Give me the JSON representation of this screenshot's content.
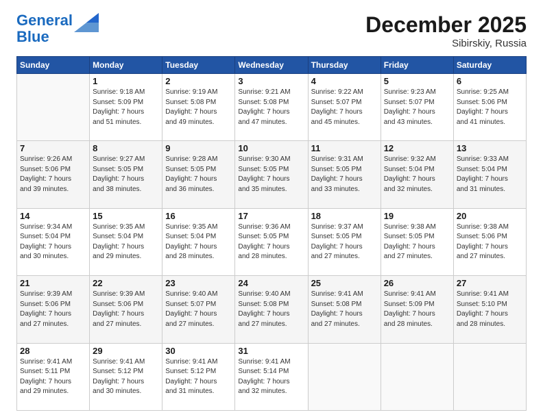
{
  "header": {
    "logo_line1": "General",
    "logo_line2": "Blue",
    "title": "December 2025",
    "subtitle": "Sibirskiy, Russia"
  },
  "weekdays": [
    "Sunday",
    "Monday",
    "Tuesday",
    "Wednesday",
    "Thursday",
    "Friday",
    "Saturday"
  ],
  "weeks": [
    [
      {
        "day": "",
        "info": ""
      },
      {
        "day": "1",
        "info": "Sunrise: 9:18 AM\nSunset: 5:09 PM\nDaylight: 7 hours\nand 51 minutes."
      },
      {
        "day": "2",
        "info": "Sunrise: 9:19 AM\nSunset: 5:08 PM\nDaylight: 7 hours\nand 49 minutes."
      },
      {
        "day": "3",
        "info": "Sunrise: 9:21 AM\nSunset: 5:08 PM\nDaylight: 7 hours\nand 47 minutes."
      },
      {
        "day": "4",
        "info": "Sunrise: 9:22 AM\nSunset: 5:07 PM\nDaylight: 7 hours\nand 45 minutes."
      },
      {
        "day": "5",
        "info": "Sunrise: 9:23 AM\nSunset: 5:07 PM\nDaylight: 7 hours\nand 43 minutes."
      },
      {
        "day": "6",
        "info": "Sunrise: 9:25 AM\nSunset: 5:06 PM\nDaylight: 7 hours\nand 41 minutes."
      }
    ],
    [
      {
        "day": "7",
        "info": "Sunrise: 9:26 AM\nSunset: 5:06 PM\nDaylight: 7 hours\nand 39 minutes."
      },
      {
        "day": "8",
        "info": "Sunrise: 9:27 AM\nSunset: 5:05 PM\nDaylight: 7 hours\nand 38 minutes."
      },
      {
        "day": "9",
        "info": "Sunrise: 9:28 AM\nSunset: 5:05 PM\nDaylight: 7 hours\nand 36 minutes."
      },
      {
        "day": "10",
        "info": "Sunrise: 9:30 AM\nSunset: 5:05 PM\nDaylight: 7 hours\nand 35 minutes."
      },
      {
        "day": "11",
        "info": "Sunrise: 9:31 AM\nSunset: 5:05 PM\nDaylight: 7 hours\nand 33 minutes."
      },
      {
        "day": "12",
        "info": "Sunrise: 9:32 AM\nSunset: 5:04 PM\nDaylight: 7 hours\nand 32 minutes."
      },
      {
        "day": "13",
        "info": "Sunrise: 9:33 AM\nSunset: 5:04 PM\nDaylight: 7 hours\nand 31 minutes."
      }
    ],
    [
      {
        "day": "14",
        "info": "Sunrise: 9:34 AM\nSunset: 5:04 PM\nDaylight: 7 hours\nand 30 minutes."
      },
      {
        "day": "15",
        "info": "Sunrise: 9:35 AM\nSunset: 5:04 PM\nDaylight: 7 hours\nand 29 minutes."
      },
      {
        "day": "16",
        "info": "Sunrise: 9:35 AM\nSunset: 5:04 PM\nDaylight: 7 hours\nand 28 minutes."
      },
      {
        "day": "17",
        "info": "Sunrise: 9:36 AM\nSunset: 5:05 PM\nDaylight: 7 hours\nand 28 minutes."
      },
      {
        "day": "18",
        "info": "Sunrise: 9:37 AM\nSunset: 5:05 PM\nDaylight: 7 hours\nand 27 minutes."
      },
      {
        "day": "19",
        "info": "Sunrise: 9:38 AM\nSunset: 5:05 PM\nDaylight: 7 hours\nand 27 minutes."
      },
      {
        "day": "20",
        "info": "Sunrise: 9:38 AM\nSunset: 5:06 PM\nDaylight: 7 hours\nand 27 minutes."
      }
    ],
    [
      {
        "day": "21",
        "info": "Sunrise: 9:39 AM\nSunset: 5:06 PM\nDaylight: 7 hours\nand 27 minutes."
      },
      {
        "day": "22",
        "info": "Sunrise: 9:39 AM\nSunset: 5:06 PM\nDaylight: 7 hours\nand 27 minutes."
      },
      {
        "day": "23",
        "info": "Sunrise: 9:40 AM\nSunset: 5:07 PM\nDaylight: 7 hours\nand 27 minutes."
      },
      {
        "day": "24",
        "info": "Sunrise: 9:40 AM\nSunset: 5:08 PM\nDaylight: 7 hours\nand 27 minutes."
      },
      {
        "day": "25",
        "info": "Sunrise: 9:41 AM\nSunset: 5:08 PM\nDaylight: 7 hours\nand 27 minutes."
      },
      {
        "day": "26",
        "info": "Sunrise: 9:41 AM\nSunset: 5:09 PM\nDaylight: 7 hours\nand 28 minutes."
      },
      {
        "day": "27",
        "info": "Sunrise: 9:41 AM\nSunset: 5:10 PM\nDaylight: 7 hours\nand 28 minutes."
      }
    ],
    [
      {
        "day": "28",
        "info": "Sunrise: 9:41 AM\nSunset: 5:11 PM\nDaylight: 7 hours\nand 29 minutes."
      },
      {
        "day": "29",
        "info": "Sunrise: 9:41 AM\nSunset: 5:12 PM\nDaylight: 7 hours\nand 30 minutes."
      },
      {
        "day": "30",
        "info": "Sunrise: 9:41 AM\nSunset: 5:12 PM\nDaylight: 7 hours\nand 31 minutes."
      },
      {
        "day": "31",
        "info": "Sunrise: 9:41 AM\nSunset: 5:14 PM\nDaylight: 7 hours\nand 32 minutes."
      },
      {
        "day": "",
        "info": ""
      },
      {
        "day": "",
        "info": ""
      },
      {
        "day": "",
        "info": ""
      }
    ]
  ]
}
